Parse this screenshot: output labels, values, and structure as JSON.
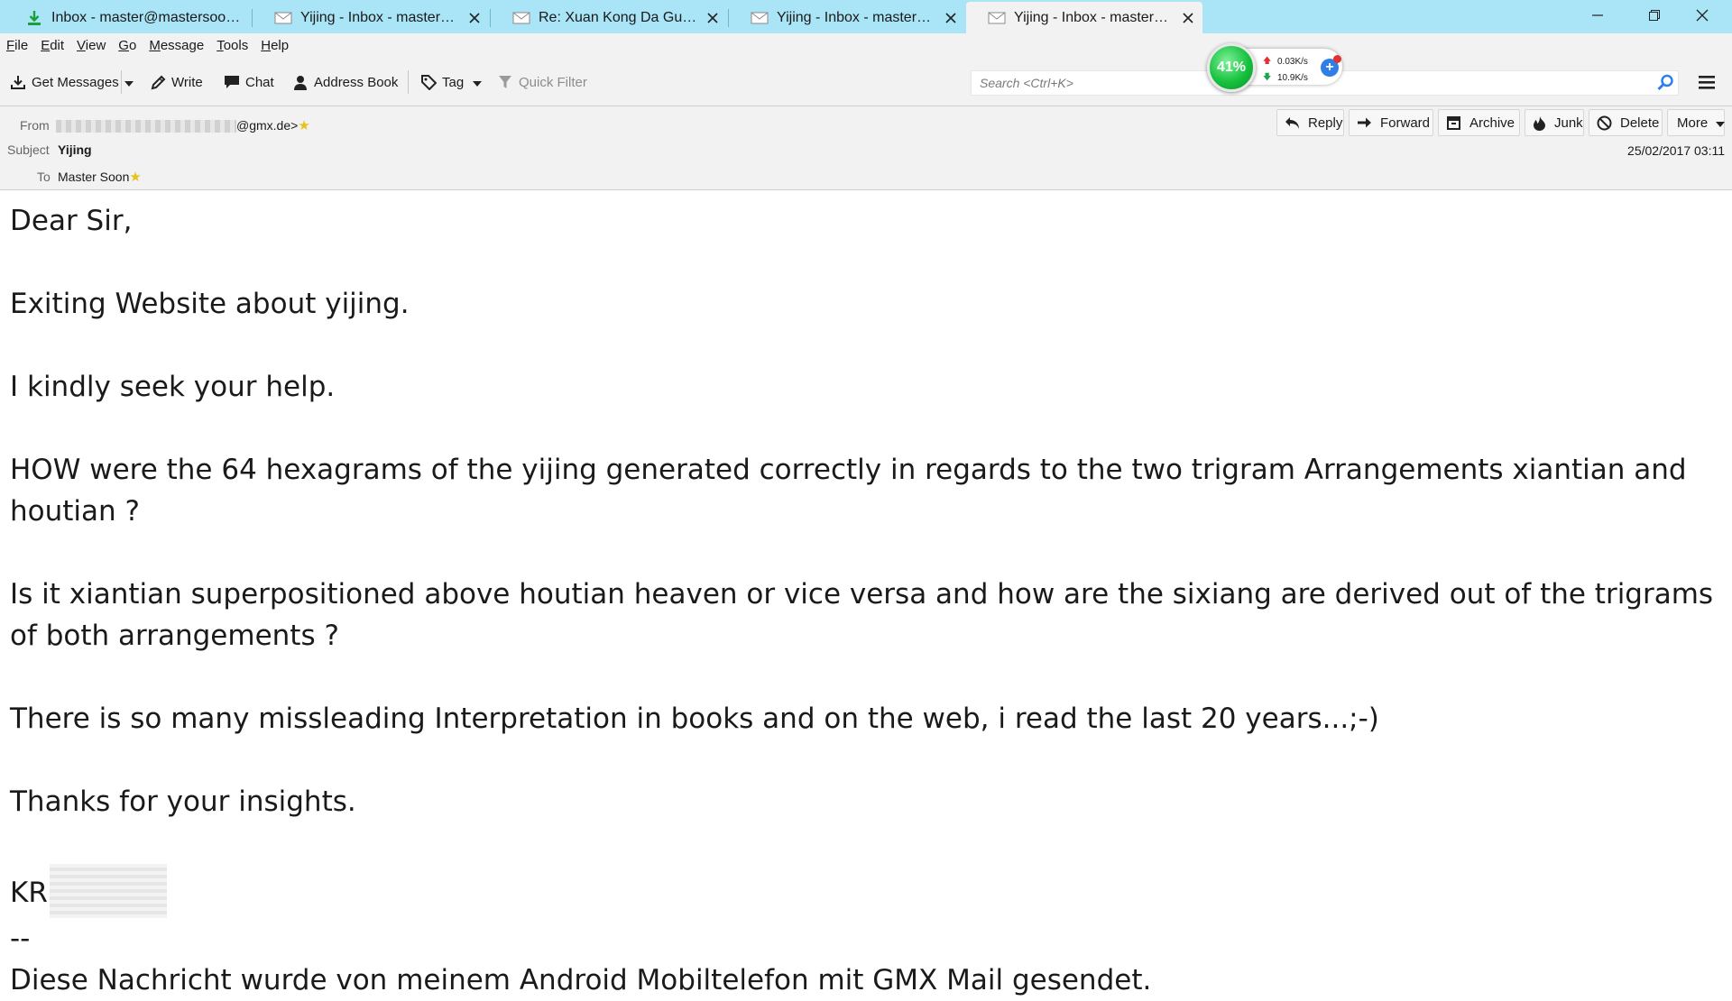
{
  "tabs": [
    {
      "title": "Inbox - master@mastersoon.c...",
      "icon": "download-icon",
      "active": false,
      "closable": false
    },
    {
      "title": "Yijing - Inbox - master@...",
      "icon": "envelope-icon",
      "active": false,
      "closable": true
    },
    {
      "title": "Re: Xuan Kong Da Gua - I...",
      "icon": "envelope-icon",
      "active": false,
      "closable": true
    },
    {
      "title": "Yijing - Inbox - master@...",
      "icon": "envelope-icon",
      "active": false,
      "closable": true
    },
    {
      "title": "Yijing - Inbox - master@...",
      "icon": "envelope-icon",
      "active": true,
      "closable": true
    }
  ],
  "menubar": {
    "items": [
      {
        "u": "F",
        "rest": "ile"
      },
      {
        "u": "E",
        "rest": "dit"
      },
      {
        "u": "V",
        "rest": "iew"
      },
      {
        "u": "G",
        "rest": "o"
      },
      {
        "u": "M",
        "rest": "essage"
      },
      {
        "u": "T",
        "rest": "ools"
      },
      {
        "u": "H",
        "rest": "elp"
      }
    ]
  },
  "toolbar": {
    "get_messages": "Get Messages",
    "write": "Write",
    "chat": "Chat",
    "address_book": "Address Book",
    "tag": "Tag",
    "quick_filter": "Quick Filter",
    "search_placeholder": "Search <Ctrl+K>"
  },
  "network_widget": {
    "percent": "41%",
    "upload": "0.03K/s",
    "download": "10.9K/s"
  },
  "header": {
    "from_label": "From",
    "from_value": "@gmx.de>",
    "subject_label": "Subject",
    "subject_value": "Yijing",
    "to_label": "To",
    "to_value": "Master Soon",
    "date": "25/02/2017 03:11",
    "buttons": {
      "reply": "Reply",
      "forward": "Forward",
      "archive": "Archive",
      "junk": "Junk",
      "delete": "Delete",
      "more": "More"
    }
  },
  "body": {
    "greeting": "Dear Sir,",
    "p1": "Exiting Website about yijing.",
    "p2": "I kindly seek your help.",
    "p3": "HOW were the 64 hexagrams of the yijing generated correctly in regards to the two trigram Arrangements xiantian and houtian ?",
    "p4": "Is it xiantian superpositioned above houtian heaven or vice versa and how are the sixiang are derived out of the trigrams of both arrangements ?",
    "p5": "There is so many missleading Interpretation in books and on the web, i read the last 20 years...;-)",
    "p6": "Thanks for your insights.",
    "sign": "KR",
    "sig_sep": "--",
    "footer": "Diese Nachricht wurde von meinem Android Mobiltelefon mit GMX Mail gesendet."
  },
  "colors": {
    "tabbar_bg": "#a9e4f7",
    "chrome_bg": "#f2f2f2",
    "accent_blue": "#2f7fe6",
    "star": "#e8c21b",
    "widget_green": "#17c23f"
  }
}
